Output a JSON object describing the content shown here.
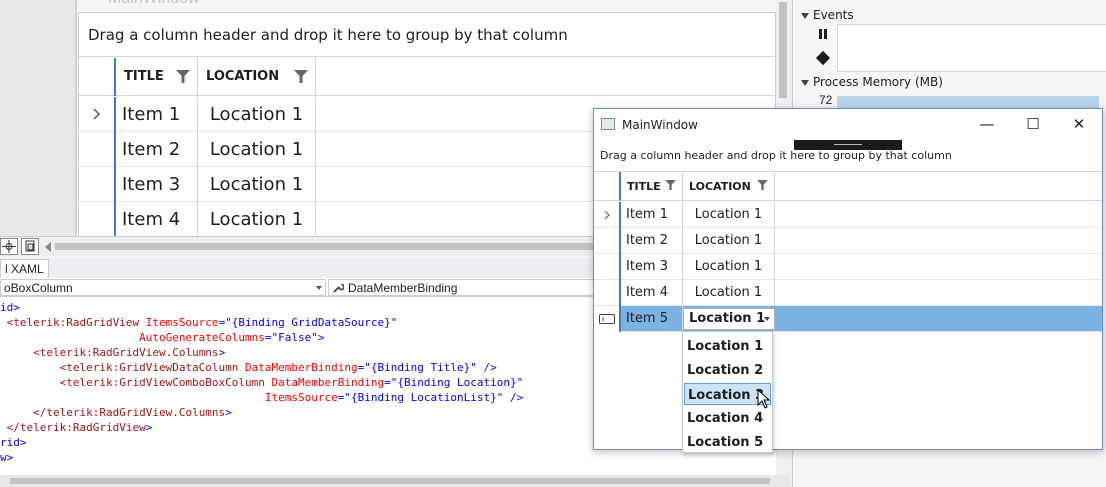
{
  "designer": {
    "faded_title": "MainWindow",
    "group_panel_text": "Drag a column header and drop it here to group by that column",
    "columns": [
      {
        "label": "TITLE"
      },
      {
        "label": "LOCATION"
      }
    ],
    "rows": [
      {
        "title": "Item 1",
        "location": "Location 1"
      },
      {
        "title": "Item 2",
        "location": "Location 1"
      },
      {
        "title": "Item 3",
        "location": "Location 1"
      },
      {
        "title": "Item 4",
        "location": "Location 1"
      }
    ]
  },
  "xaml_pane": {
    "tab_label": "l XAML",
    "nav_left": "oBoxColumn",
    "nav_right": "DataMemberBinding",
    "code_lines": [
      {
        "indent": "",
        "prefix": "id>",
        "parts": []
      },
      {
        "indent": " ",
        "prefix": "",
        "tag": "<telerik:RadGridView",
        "attr1": " ItemsSource",
        "val1": "=\"{Binding GridDataSource}\"",
        "rest": ""
      },
      {
        "indent": "                     ",
        "prefix": "",
        "tag": "",
        "attr1": "AutoGenerateColumns",
        "val1": "=\"False\"",
        "rest": ">"
      },
      {
        "indent": "     ",
        "prefix": "",
        "tag": "<telerik:RadGridView.Columns",
        "attr1": "",
        "val1": "",
        "rest": ">"
      },
      {
        "indent": "         ",
        "prefix": "",
        "tag": "<telerik:GridViewDataColumn",
        "attr1": " DataMemberBinding",
        "val1": "=\"{Binding Title}\"",
        "rest": " />"
      },
      {
        "indent": "         ",
        "prefix": "",
        "tag": "<telerik:GridViewComboBoxColumn",
        "attr1": " DataMemberBinding",
        "val1": "=\"{Binding Location}\"",
        "rest": ""
      },
      {
        "indent": "                                        ",
        "prefix": "",
        "tag": "",
        "attr1": "ItemsSource",
        "val1": "=\"{Binding LocationList}\"",
        "rest": " />"
      },
      {
        "indent": "     ",
        "prefix": "",
        "tag": "</telerik:RadGridView.Columns",
        "attr1": "",
        "val1": "",
        "rest": ">"
      },
      {
        "indent": " ",
        "prefix": "",
        "tag": "</telerik:RadGridView",
        "attr1": "",
        "val1": "",
        "rest": ">"
      },
      {
        "indent": "",
        "prefix": "rid>",
        "parts": []
      },
      {
        "indent": "",
        "prefix": "w>",
        "parts": []
      }
    ]
  },
  "diagnostics": {
    "events_label": "Events",
    "memory_label": "Process Memory (MB)",
    "memory_value": "72"
  },
  "main_window": {
    "title": "MainWindow",
    "minimize": "—",
    "maximize": "☐",
    "close": "✕",
    "group_panel_text": "Drag a column header and drop it here to group by that column",
    "columns": [
      {
        "label": "TITLE"
      },
      {
        "label": "LOCATION"
      }
    ],
    "rows": [
      {
        "title": "Item 1",
        "location": "Location 1"
      },
      {
        "title": "Item 2",
        "location": "Location 1"
      },
      {
        "title": "Item 3",
        "location": "Location 1"
      },
      {
        "title": "Item 4",
        "location": "Location 1"
      }
    ],
    "edit_row": {
      "title": "Item 5",
      "location": "Location 1"
    },
    "dropdown_options": [
      "Location 1",
      "Location 2",
      "Location 3",
      "Location 4",
      "Location 5"
    ],
    "highlighted_option": "Location 3"
  },
  "colors": {
    "selection": "#7ab2e2",
    "highlight": "#cde3f4",
    "indicator": "#3c7fc4"
  }
}
